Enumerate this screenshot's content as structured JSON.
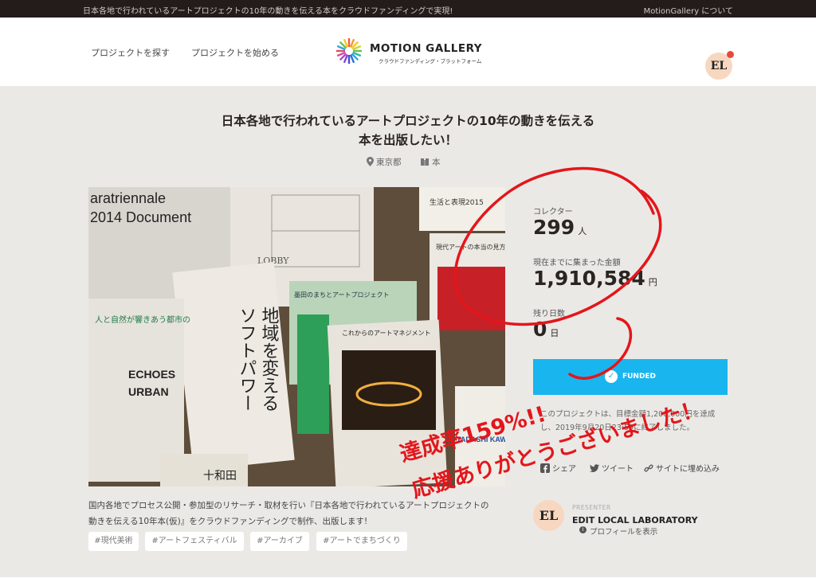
{
  "topbar": {
    "announcement": "日本各地で行われているアートプロジェクトの10年の動きを伝える本をクラウドファンディングで実現!",
    "about_link": "MotionGallery について"
  },
  "nav": {
    "find": "プロジェクトを探す",
    "start": "プロジェクトを始める"
  },
  "logo": {
    "name": "MOTION GALLERY",
    "tagline": "クラウドファンディング・プラットフォーム"
  },
  "user": {
    "initials": "EL"
  },
  "project": {
    "title_line1": "日本各地で行われているアートプロジェクトの10年の動きを伝える",
    "title_line2": "本を出版したい！",
    "location": "東京都",
    "category": "本",
    "description_line1": "国内各地でプロセス公開・参加型のリサーチ・取材を行い『日本各地で行われているアートプロジェクトの",
    "description_line2": "動きを伝える10年本(仮)』をクラウドファンディングで制作、出版します!",
    "tags": [
      "#現代美術",
      "#アートフェスティバル",
      "#アーカイブ",
      "#アートでまちづくり"
    ]
  },
  "hero_text": {
    "book1_a": "aratriennale",
    "book1_b": "2014 Document",
    "book2_a": "地域を変える",
    "book2_b": "ソフトパワー",
    "book3": "人と自然が響きあう都市の",
    "book3_en1": "ECHOES",
    "book3_en2": "URBAN",
    "book4": "これからのアートマネジメント",
    "book5": "墨田のまちとアートプロジェクト",
    "book6": "十和田",
    "book7": "LOBBY",
    "book8": "生活と表現2015",
    "book9": "現代アートの本当の見方",
    "book10": "TADASHI KAWAMATA"
  },
  "stats": {
    "collectors_label": "コレクター",
    "collectors_value": "299",
    "collectors_unit": "人",
    "amount_label": "現在までに集まった金額",
    "amount_value": "1,910,584",
    "amount_unit": "円",
    "days_label": "残り日数",
    "days_value": "0",
    "days_unit": "日"
  },
  "funded": {
    "label": "FUNDED",
    "note_line1": "このプロジェクトは、目標金額1,200,000円を達成",
    "note_line2": "し、2019年9月20日23:59に終了しました。"
  },
  "share": {
    "facebook": "シェア",
    "twitter": "ツイート",
    "embed": "サイトに埋め込み"
  },
  "presenter": {
    "role": "PRESENTER",
    "initials": "EL",
    "name": "EDIT LOCAL LABORATORY",
    "profile_link": "プロフィールを表示"
  },
  "handwriting": {
    "line1": "達成率159%!!",
    "line2": "応援ありがとうございました！"
  },
  "colors": {
    "funded_button": "#19b5ef",
    "annotation_red": "#e3161b",
    "topbar": "#231c1a",
    "page_bg": "#ebe9e6"
  }
}
